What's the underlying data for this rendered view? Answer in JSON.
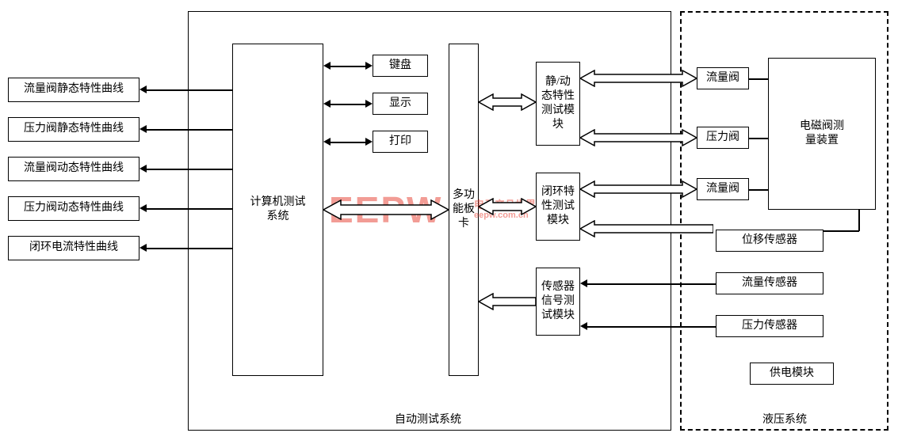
{
  "left_outputs": [
    "流量阀静态特性曲线",
    "压力阀静态特性曲线",
    "流量阀动态特性曲线",
    "压力阀动态特性曲线",
    "闭环电流特性曲线"
  ],
  "auto_test_container_label": "自动测试系统",
  "hydraulic_container_label": "液压系统",
  "computer_test_system": "计算机测试\n系统",
  "peripherals": [
    "键盘",
    "显示",
    "打印"
  ],
  "multifunction_card": "多功\n能板\n卡",
  "modules": {
    "static_dynamic": "静/动\n态特性\n测试模\n块",
    "closed_loop": "闭环特\n性测试\n模块",
    "sensor_signal": "传感器\n信号测\n试模块"
  },
  "valves": [
    "流量阀",
    "压力阀",
    "流量阀"
  ],
  "solenoid_measure": "电磁阀测\n量装置",
  "sensors": [
    "位移传感器",
    "流量传感器",
    "压力传感器"
  ],
  "power_module": "供电模块",
  "watermark_main": "EEPW",
  "watermark_sub": "电子产品世界",
  "watermark_url": "eepw.com.cn"
}
